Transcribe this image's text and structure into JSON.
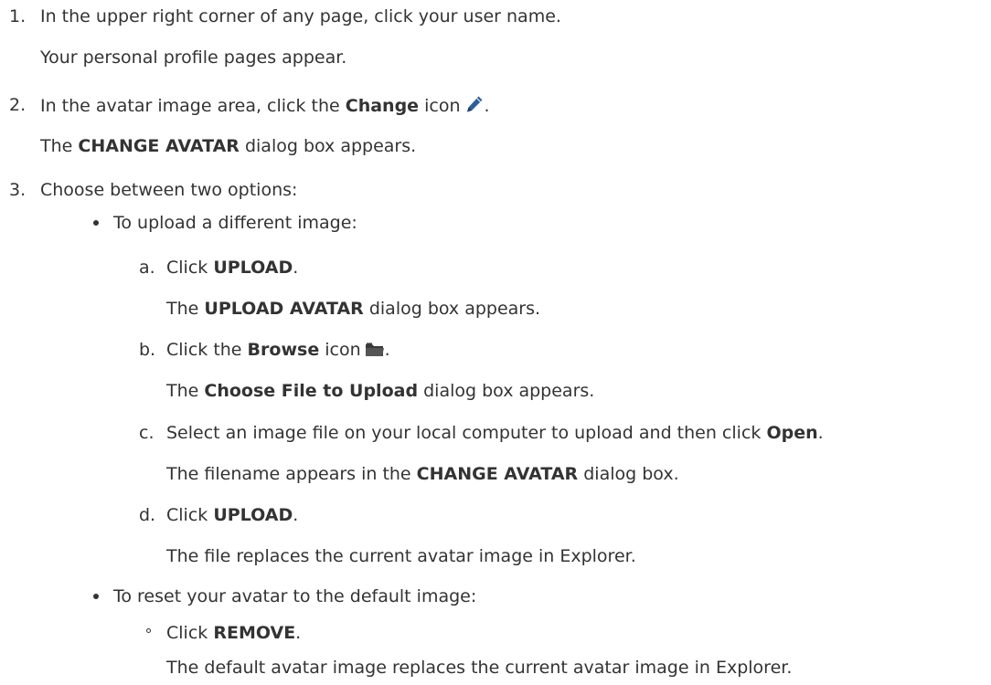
{
  "steps": [
    {
      "marker": "1.",
      "instruction": "In the upper right corner of any page, click your user name.",
      "result": "Your personal profile pages appear."
    },
    {
      "marker": "2.",
      "instruction_pre": "In the avatar image area, click the ",
      "instruction_bold": "Change",
      "instruction_post": " icon",
      "instruction_end": ".",
      "icon": "pencil-icon",
      "result_pre": "The ",
      "result_bold": "CHANGE AVATAR",
      "result_post": " dialog box appears."
    },
    {
      "marker": "3.",
      "instruction": "Choose between two options:",
      "options": [
        {
          "text": "To upload a different image:",
          "substeps": [
            {
              "marker": "a.",
              "pre": "Click ",
              "bold": "UPLOAD",
              "post": ".",
              "result_pre": "The ",
              "result_bold": "UPLOAD AVATAR",
              "result_post": " dialog box appears."
            },
            {
              "marker": "b.",
              "pre": "Click the ",
              "bold": "Browse",
              "post": " icon",
              "end": ".",
              "icon": "folder-icon",
              "result_pre": "The ",
              "result_bold": "Choose File to Upload",
              "result_post": " dialog box appears."
            },
            {
              "marker": "c.",
              "pre": "Select an image file on your local computer to upload and then click ",
              "bold": "Open",
              "post": ".",
              "result_pre": "The filename appears in the ",
              "result_bold": "CHANGE AVATAR",
              "result_post": " dialog box."
            },
            {
              "marker": "d.",
              "pre": "Click ",
              "bold": "UPLOAD",
              "post": ".",
              "result": "The file replaces the current avatar image in Explorer."
            }
          ]
        },
        {
          "text": "To reset your avatar to the default image:",
          "substeps": [
            {
              "pre": "Click ",
              "bold": "REMOVE",
              "post": ".",
              "result": "The default avatar image replaces the current avatar image in Explorer."
            }
          ]
        }
      ]
    }
  ],
  "colors": {
    "text": "#333333",
    "pencil": "#2d5f9a",
    "folder": "#3a3a3a"
  }
}
